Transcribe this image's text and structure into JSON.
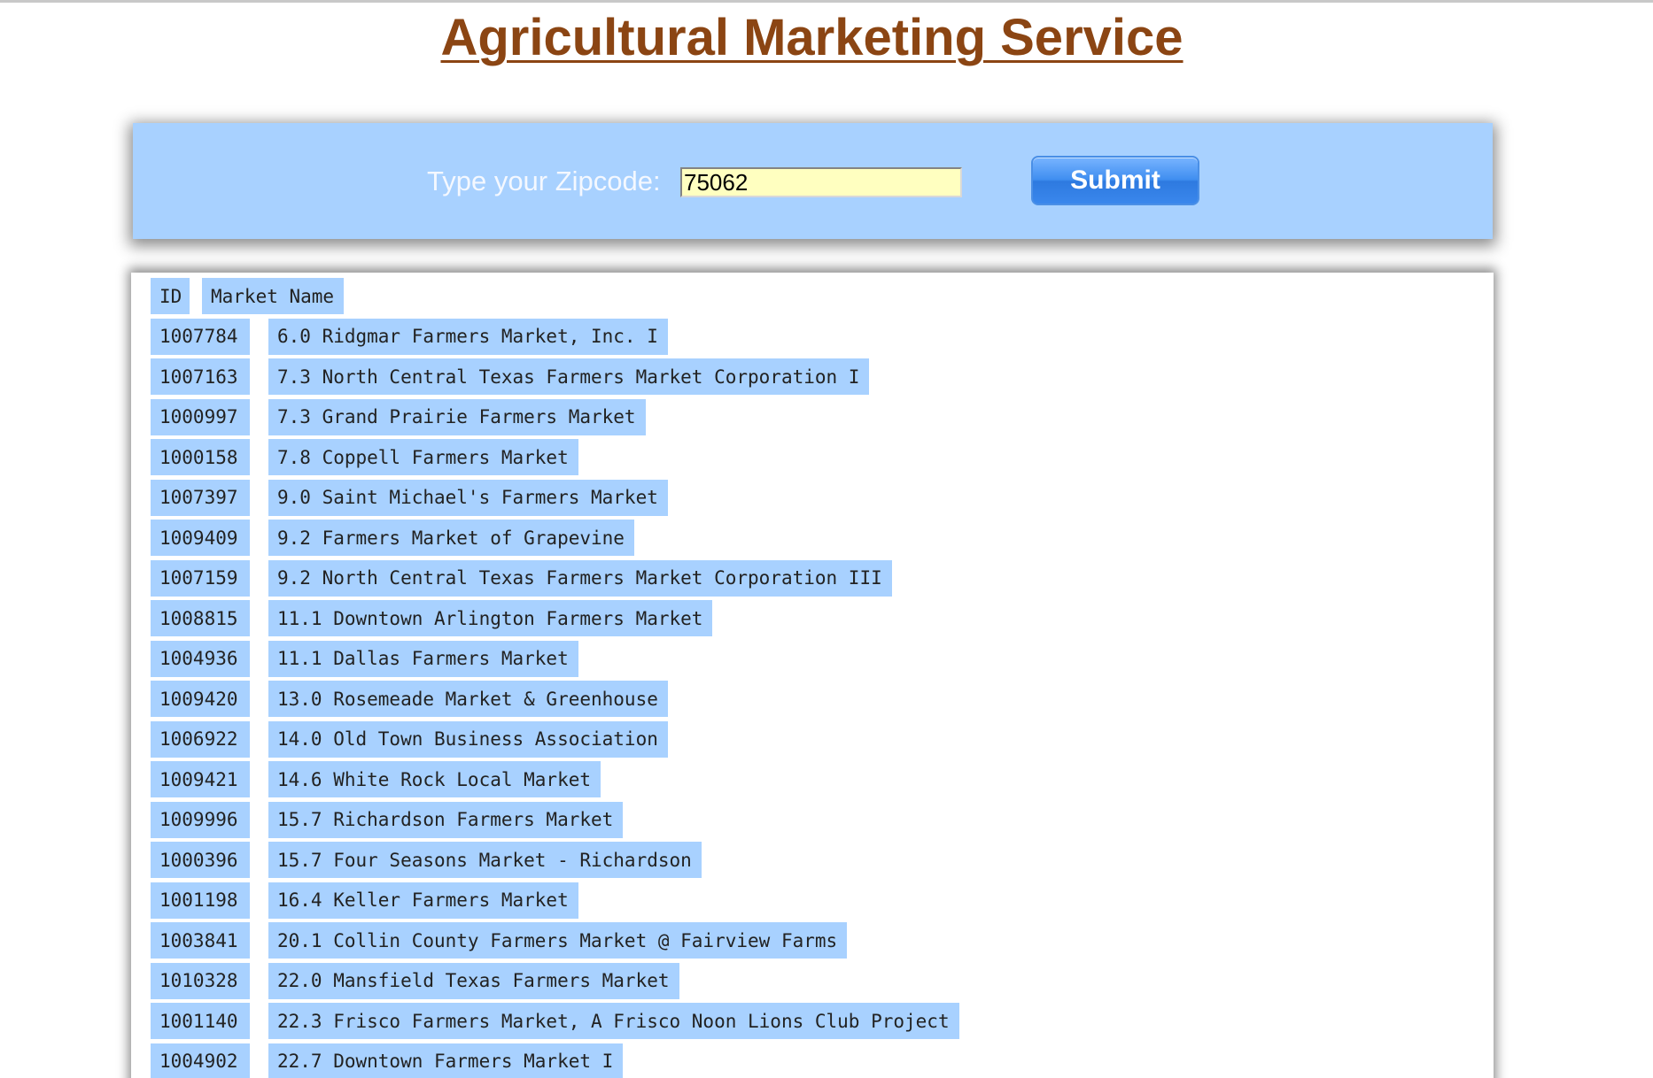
{
  "page": {
    "title": "Agricultural Marketing Service"
  },
  "search": {
    "label": "Type your Zipcode:",
    "zipcode_value": "75062",
    "submit_label": "Submit"
  },
  "table": {
    "headers": {
      "id": "ID",
      "name": "Market Name"
    },
    "rows": [
      {
        "id": "1007784",
        "name": "6.0 Ridgmar Farmers Market, Inc. I"
      },
      {
        "id": "1007163",
        "name": "7.3 North Central Texas Farmers Market Corporation I"
      },
      {
        "id": "1000997",
        "name": "7.3 Grand Prairie Farmers Market"
      },
      {
        "id": "1000158",
        "name": "7.8 Coppell Farmers Market"
      },
      {
        "id": "1007397",
        "name": "9.0 Saint Michael's Farmers Market"
      },
      {
        "id": "1009409",
        "name": "9.2 Farmers Market of Grapevine"
      },
      {
        "id": "1007159",
        "name": "9.2 North Central Texas Farmers Market Corporation III"
      },
      {
        "id": "1008815",
        "name": "11.1 Downtown Arlington Farmers Market"
      },
      {
        "id": "1004936",
        "name": "11.1 Dallas Farmers Market"
      },
      {
        "id": "1009420",
        "name": "13.0 Rosemeade Market & Greenhouse"
      },
      {
        "id": "1006922",
        "name": "14.0 Old Town Business Association"
      },
      {
        "id": "1009421",
        "name": "14.6 White Rock Local Market"
      },
      {
        "id": "1009996",
        "name": "15.7 Richardson Farmers Market"
      },
      {
        "id": "1000396",
        "name": "15.7 Four Seasons Market - Richardson"
      },
      {
        "id": "1001198",
        "name": "16.4 Keller Farmers Market"
      },
      {
        "id": "1003841",
        "name": "20.1 Collin County Farmers Market @ Fairview Farms"
      },
      {
        "id": "1010328",
        "name": "22.0 Mansfield Texas Farmers Market"
      },
      {
        "id": "1001140",
        "name": "22.3 Frisco Farmers Market, A Frisco Noon Lions Club Project"
      },
      {
        "id": "1004902",
        "name": "22.7 Downtown Farmers Market I"
      }
    ]
  },
  "colors": {
    "title": "#8b4513",
    "panel": "#a8d1ff",
    "input_background": "#ffffc0",
    "button": "#3f8ef0"
  }
}
